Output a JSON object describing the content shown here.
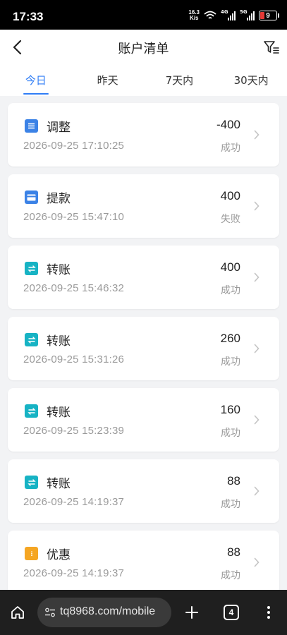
{
  "status_bar": {
    "time": "17:33",
    "net_speed_value": "16.3",
    "net_speed_unit": "K/s",
    "sim1_label": "4G",
    "sim2_label": "5G",
    "battery": "9"
  },
  "header": {
    "title": "账户清单"
  },
  "tabs": [
    {
      "label": "今日",
      "active": true
    },
    {
      "label": "昨天",
      "active": false
    },
    {
      "label": "7天内",
      "active": false
    },
    {
      "label": "30天内",
      "active": false
    }
  ],
  "records": [
    {
      "type": "调整",
      "icon": "adjust-icon",
      "icon_color": "#3b82e6",
      "date": "2026-09-25 17:10:25",
      "amount": "-400",
      "status": "成功"
    },
    {
      "type": "提款",
      "icon": "card-icon",
      "icon_color": "#3b82e6",
      "date": "2026-09-25 15:47:10",
      "amount": "400",
      "status": "失败"
    },
    {
      "type": "转账",
      "icon": "transfer-icon",
      "icon_color": "#17b3c4",
      "date": "2026-09-25 15:46:32",
      "amount": "400",
      "status": "成功"
    },
    {
      "type": "转账",
      "icon": "transfer-icon",
      "icon_color": "#17b3c4",
      "date": "2026-09-25 15:31:26",
      "amount": "260",
      "status": "成功"
    },
    {
      "type": "转账",
      "icon": "transfer-icon",
      "icon_color": "#17b3c4",
      "date": "2026-09-25 15:23:39",
      "amount": "160",
      "status": "成功"
    },
    {
      "type": "转账",
      "icon": "transfer-icon",
      "icon_color": "#17b3c4",
      "date": "2026-09-25 14:19:37",
      "amount": "88",
      "status": "成功"
    },
    {
      "type": "优惠",
      "icon": "coupon-icon",
      "icon_color": "#f5a623",
      "date": "2026-09-25 14:19:37",
      "amount": "88",
      "status": "成功"
    }
  ],
  "browser": {
    "url": "tq8968.com/mobile",
    "tab_count": "4"
  },
  "colors": {
    "accent": "#2f7df6",
    "muted": "#9a9a9a"
  }
}
